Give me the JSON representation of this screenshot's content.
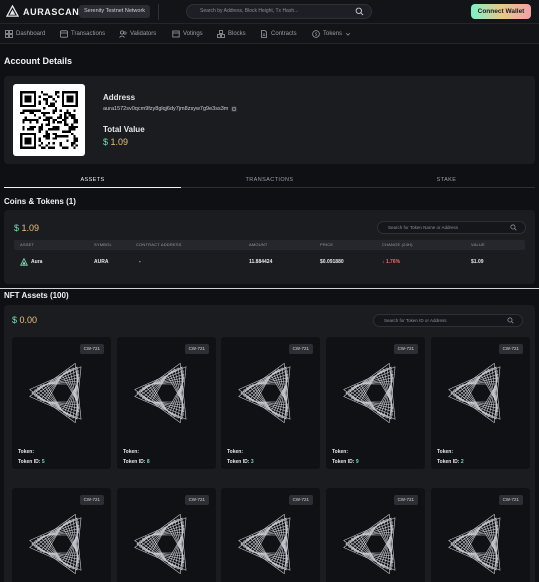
{
  "header": {
    "logo_text": "AURASCAN",
    "network": "Serenity Testnet Network",
    "search_placeholder": "Search by Address, Block Height, Tx Hash...",
    "connect_label": "Connect Wallet"
  },
  "nav": [
    {
      "label": "Dashboard",
      "icon": "grid-icon"
    },
    {
      "label": "Transactions",
      "icon": "list-icon"
    },
    {
      "label": "Validators",
      "icon": "users-icon"
    },
    {
      "label": "Votings",
      "icon": "ballot-icon"
    },
    {
      "label": "Blocks",
      "icon": "cubes-icon"
    },
    {
      "label": "Contracts",
      "icon": "document-icon"
    },
    {
      "label": "Tokens",
      "icon": "coin-icon"
    }
  ],
  "page_title": "Account Details",
  "account": {
    "address_label": "Address",
    "address": "aura1572sv0qcm9fzy8glqj6dy7jm8zsyw7g9e3ss3m",
    "total_value_label": "Total Value",
    "total_value_symbol": "$",
    "total_value": "1.09"
  },
  "tabs": [
    "ASSETS",
    "TRANSACTIONS",
    "STAKE"
  ],
  "coins": {
    "title": "Coins & Tokens (1)",
    "total_symbol": "$",
    "total": "1.09",
    "search_placeholder": "Search for Token Name or Address",
    "columns": [
      "ASSET",
      "SYMBOL",
      "CONTRACT ADDRESS",
      "AMOUNT",
      "PRICE",
      "CHANGE (24H)",
      "VALUE"
    ],
    "rows": [
      {
        "asset": "Aura",
        "symbol": "AURA",
        "contract": "-",
        "amount": "11.884424",
        "price": "$0.091880",
        "change": "↓ 1.76%",
        "value": "$1.09"
      }
    ]
  },
  "nft": {
    "title": "NFT Assets (100)",
    "total_symbol": "$",
    "total": "0.00",
    "search_placeholder": "Search for Token ID or Address",
    "token_label": "Token:",
    "token_id_label": "Token ID:",
    "badge": "CW-721",
    "items_row1": [
      "5",
      "8",
      "3",
      "9",
      "2"
    ],
    "items_row2": [
      "",
      "",
      "",
      "",
      ""
    ]
  },
  "colors": {
    "accent_green": "#6ee0b2",
    "accent_gold": "#e7c07f",
    "negative": "#f06a6a"
  }
}
